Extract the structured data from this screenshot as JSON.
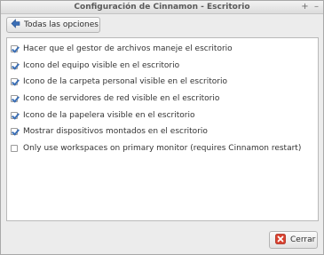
{
  "window": {
    "title": "Configuración de Cinnamon - Escritorio",
    "minimize_glyph": "+",
    "close_glyph": "–"
  },
  "toolbar": {
    "back_label": "Todas las opciones",
    "back_icon": "arrow-left-icon"
  },
  "options": [
    {
      "label": "Hacer que el gestor de archivos maneje el escritorio",
      "checked": true
    },
    {
      "label": "Icono del equipo visible en el escritorio",
      "checked": true
    },
    {
      "label": "Icono de la carpeta personal visible en el escritorio",
      "checked": true
    },
    {
      "label": "Icono de servidores de red visible en el escritorio",
      "checked": true
    },
    {
      "label": "Icono de la papelera visible en el escritorio",
      "checked": true
    },
    {
      "label": "Mostrar dispositivos montados en el escritorio",
      "checked": true
    },
    {
      "label": "Only use workspaces on primary monitor (requires Cinnamon restart)",
      "checked": false
    }
  ],
  "footer": {
    "close_label": "Cerrar",
    "close_icon": "red-x-icon"
  },
  "colors": {
    "accent": "#3b6fb6",
    "close_icon": "#d9412f"
  }
}
